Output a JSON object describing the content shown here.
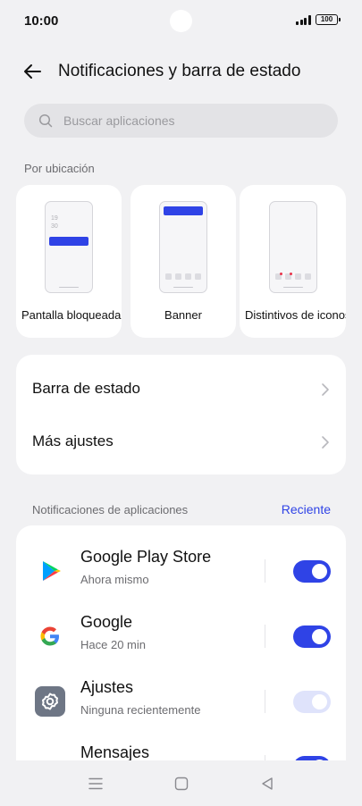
{
  "status_bar": {
    "time": "10:00",
    "battery": "100"
  },
  "header": {
    "title": "Notificaciones y barra de estado"
  },
  "search": {
    "placeholder": "Buscar aplicaciones"
  },
  "location": {
    "section_label": "Por ubicación",
    "cards": [
      {
        "label": "Pantalla bloqueada",
        "mock_time": "19\n30"
      },
      {
        "label": "Banner"
      },
      {
        "label": "Distintivos de iconos"
      }
    ]
  },
  "settings": {
    "rows": [
      {
        "label": "Barra de estado"
      },
      {
        "label": "Más ajustes"
      }
    ]
  },
  "apps": {
    "section_label": "Notificaciones de aplicaciones",
    "sort_label": "Reciente",
    "items": [
      {
        "name": "Google Play Store",
        "subtitle": "Ahora mismo",
        "enabled": true,
        "icon": "google-play-store-icon"
      },
      {
        "name": "Google",
        "subtitle": "Hace 20 min",
        "enabled": true,
        "icon": "google-icon"
      },
      {
        "name": "Ajustes",
        "subtitle": "Ninguna recientemente",
        "enabled": true,
        "locked": true,
        "icon": "settings-icon"
      },
      {
        "name": "Mensajes",
        "subtitle": "",
        "enabled": true,
        "icon": "messages-icon"
      }
    ]
  },
  "colors": {
    "accent": "#2f43e6",
    "background": "#f1f1f3",
    "card": "#ffffff"
  }
}
